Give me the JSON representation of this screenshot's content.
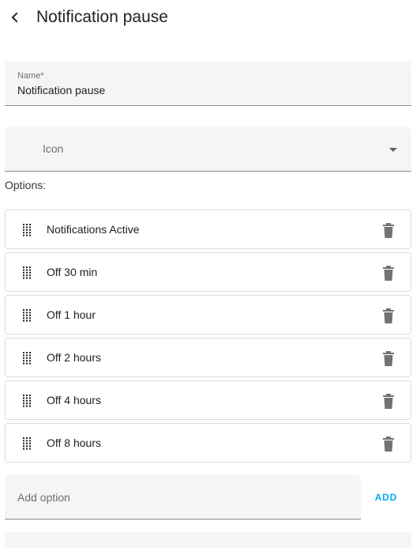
{
  "header": {
    "title": "Notification pause",
    "back_icon": "chevron-left-icon"
  },
  "name_field": {
    "label": "Name*",
    "value": "Notification pause"
  },
  "icon_field": {
    "label": "Icon",
    "dropdown_icon": "dropdown-arrow-icon"
  },
  "options_section": {
    "label": "Options:",
    "items": [
      {
        "label": "Notifications Active"
      },
      {
        "label": "Off 30 min"
      },
      {
        "label": "Off 1 hour"
      },
      {
        "label": "Off 2 hours"
      },
      {
        "label": "Off 4 hours"
      },
      {
        "label": "Off 8 hours"
      }
    ],
    "drag_icon": "drag-handle-icon",
    "delete_icon": "trash-icon"
  },
  "add_option": {
    "placeholder": "Add option",
    "value": "",
    "button_label": "ADD"
  },
  "colors": {
    "accent": "#03a9f4",
    "field_background": "#f5f5f5",
    "icon_gray": "#727272"
  }
}
